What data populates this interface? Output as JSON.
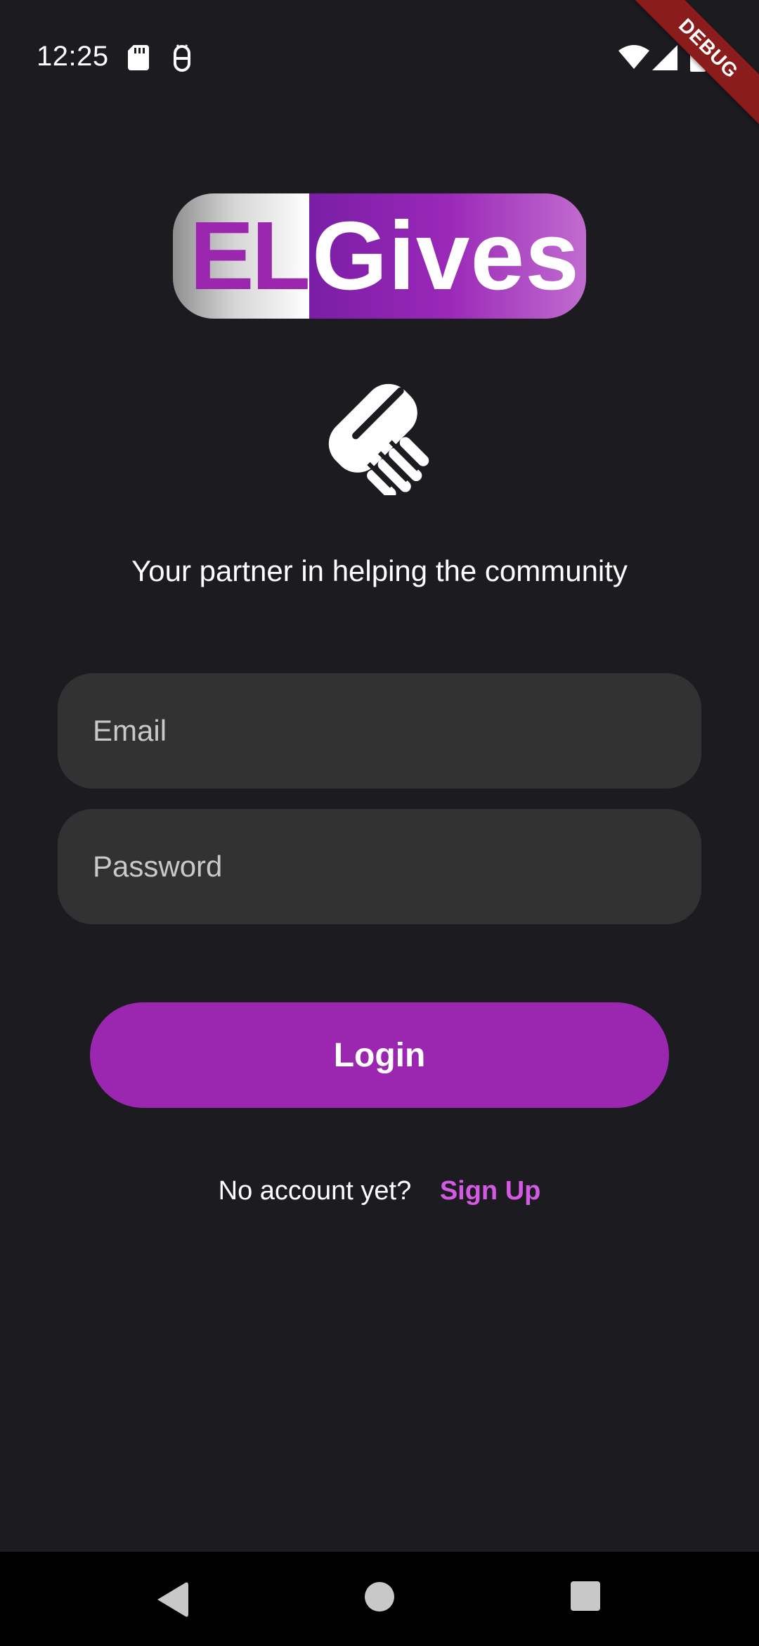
{
  "status_bar": {
    "time": "12:25",
    "icons": [
      "sd-card-icon",
      "usb-debug-icon",
      "wifi-icon",
      "cell-signal-icon",
      "battery-icon"
    ]
  },
  "debug_banner": "DEBUG",
  "logo": {
    "part1": "EL",
    "part2": "Gives"
  },
  "tagline": "Your partner in helping the community",
  "form": {
    "email_placeholder": "Email",
    "email_value": "",
    "password_placeholder": "Password",
    "password_value": ""
  },
  "login_label": "Login",
  "signup": {
    "prompt": "No account yet?",
    "link": "Sign Up"
  },
  "nav": {
    "icons": [
      "back-icon",
      "home-icon",
      "recents-icon"
    ]
  },
  "colors": {
    "background": "#1c1b20",
    "accent": "#9b27b0",
    "link": "#d45ae6",
    "input_bg": "#323232"
  }
}
